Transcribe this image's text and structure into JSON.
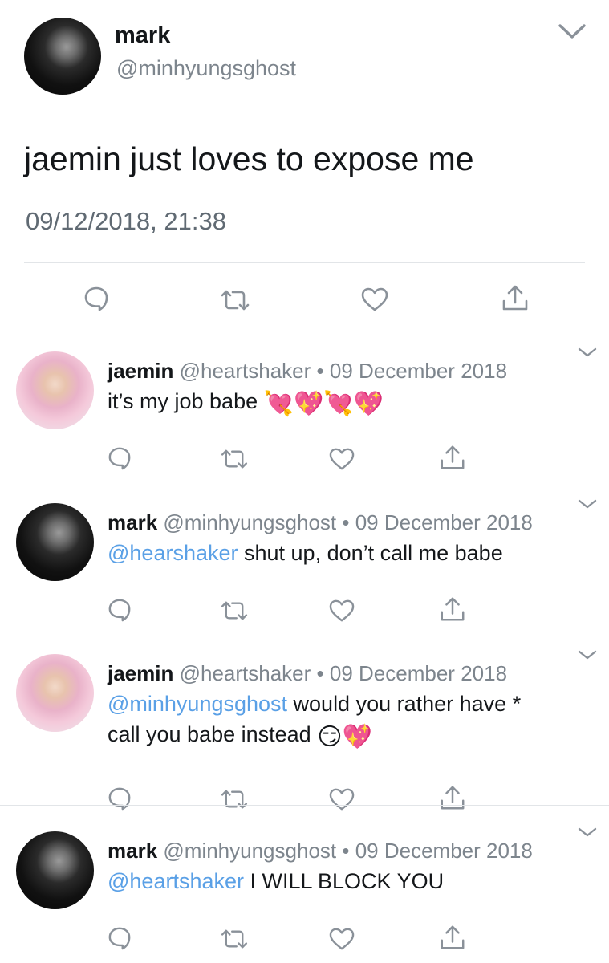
{
  "main_tweet": {
    "name": "mark",
    "handle": "@minhyungsghost",
    "text": "jaemin just loves to expose me",
    "timestamp": "09/12/2018, 21:38"
  },
  "replies": [
    {
      "name": "jaemin",
      "handle": "@heartshaker",
      "separator": "•",
      "date": "09 December 2018",
      "mention": "",
      "text": "it’s my job babe",
      "text2": "",
      "emojis": "💘💖💘💖",
      "avatar": "jaemin"
    },
    {
      "name": "mark",
      "handle": "@minhyungsghost",
      "separator": "•",
      "date": "09 December 2018",
      "mention": "@hearshaker",
      "text": " shut up, don’t call me babe",
      "text2": "",
      "emojis": "",
      "avatar": "mark"
    },
    {
      "name": "jaemin",
      "handle": "@heartshaker",
      "separator": "•",
      "date": "09 December 2018",
      "mention": "@minhyungsghost",
      "text": " would you rather have *",
      "text2": "call you babe instead",
      "emojis": "😏💖",
      "avatar": "jaemin"
    },
    {
      "name": "mark",
      "handle": "@minhyungsghost",
      "separator": "•",
      "date": "09 December 2018",
      "mention": "@heartshaker",
      "text": " I WILL BLOCK YOU",
      "text2": "",
      "emojis": "",
      "avatar": "mark"
    }
  ],
  "icons": {
    "reply": "speech-bubble-icon",
    "retweet": "retweet-icon",
    "like": "heart-icon",
    "share": "share-icon",
    "more": "chevron-down-icon"
  },
  "colors": {
    "mention": "#5aa0e6",
    "meta": "#7d858d",
    "icon": "#8a9199",
    "divider": "#e2e5e8"
  }
}
